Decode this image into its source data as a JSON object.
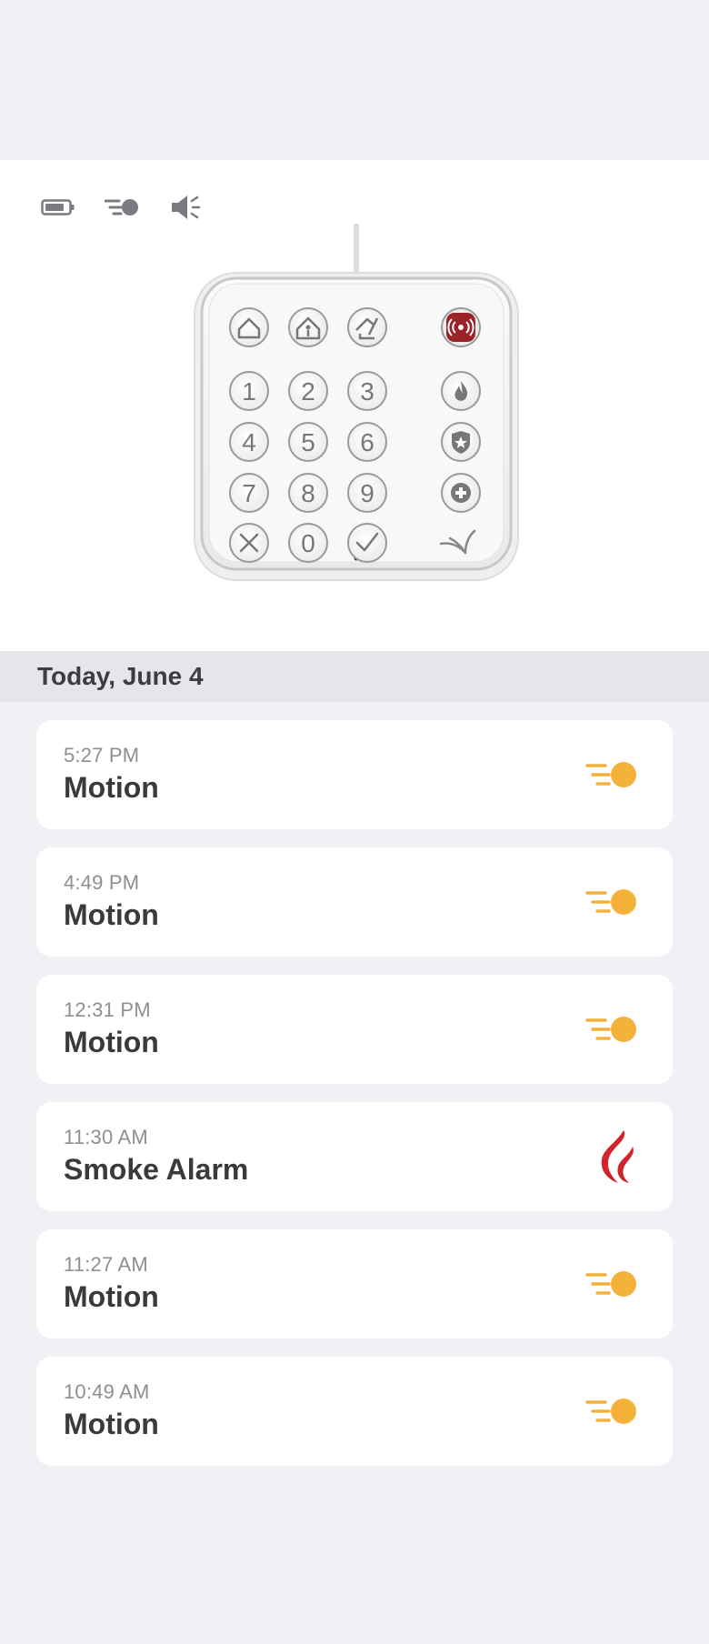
{
  "header": {
    "status_icons": [
      "battery-icon",
      "motion-sensor-icon",
      "speaker-icon"
    ]
  },
  "keypad": {
    "image": "keypad-device",
    "mode_buttons": [
      "home-icon",
      "home-stay-icon",
      "away-icon"
    ],
    "panic_button": "panic-icon",
    "digits": [
      "1",
      "2",
      "3",
      "4",
      "5",
      "6",
      "7",
      "8",
      "9",
      "0"
    ],
    "side_buttons": [
      "fire-icon",
      "police-icon",
      "medical-icon"
    ],
    "cancel": "×",
    "confirm": "✓",
    "accent_color": "#9b2226"
  },
  "date_header": "Today, June 4",
  "events": [
    {
      "time": "5:27 PM",
      "name": "Motion",
      "icon": "motion-icon"
    },
    {
      "time": "4:49 PM",
      "name": "Motion",
      "icon": "motion-icon"
    },
    {
      "time": "12:31 PM",
      "name": "Motion",
      "icon": "motion-icon"
    },
    {
      "time": "11:30 AM",
      "name": "Smoke Alarm",
      "icon": "smoke-alarm-icon"
    },
    {
      "time": "11:27 AM",
      "name": "Motion",
      "icon": "motion-icon"
    },
    {
      "time": "10:49 AM",
      "name": "Motion",
      "icon": "motion-icon"
    }
  ],
  "colors": {
    "motion": "#f5b23a",
    "smoke": "#d0242e",
    "background": "#f0f0f5",
    "date_bar": "#e5e5ea"
  }
}
